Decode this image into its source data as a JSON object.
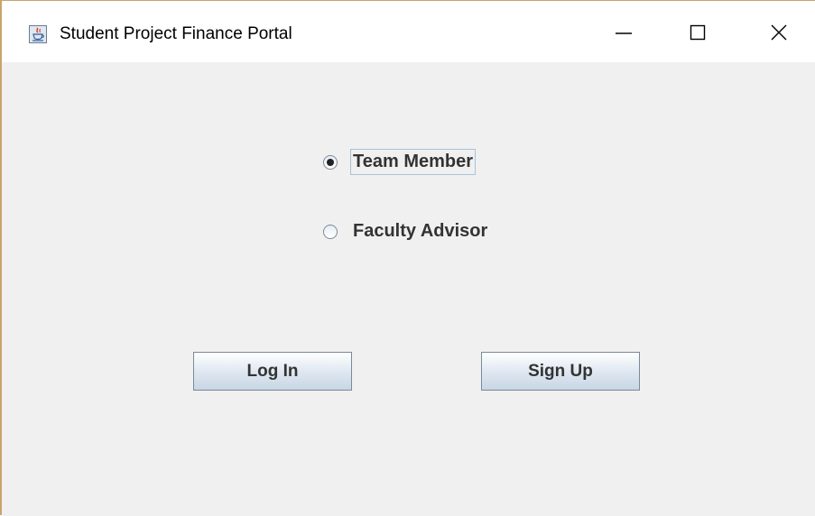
{
  "window": {
    "title": "Student Project Finance Portal",
    "app_icon": "java-cup-icon",
    "controls": {
      "minimize_icon": "minimize-icon",
      "maximize_icon": "maximize-icon",
      "close_icon": "close-icon"
    }
  },
  "role_selection": {
    "options": [
      {
        "label": "Team Member",
        "selected": true
      },
      {
        "label": "Faculty Advisor",
        "selected": false
      }
    ]
  },
  "actions": {
    "login_label": "Log In",
    "signup_label": "Sign Up"
  },
  "colors": {
    "window_border": "#c9a46a",
    "client_background": "#f0f0f0",
    "focus_border": "#a9c1d9"
  }
}
